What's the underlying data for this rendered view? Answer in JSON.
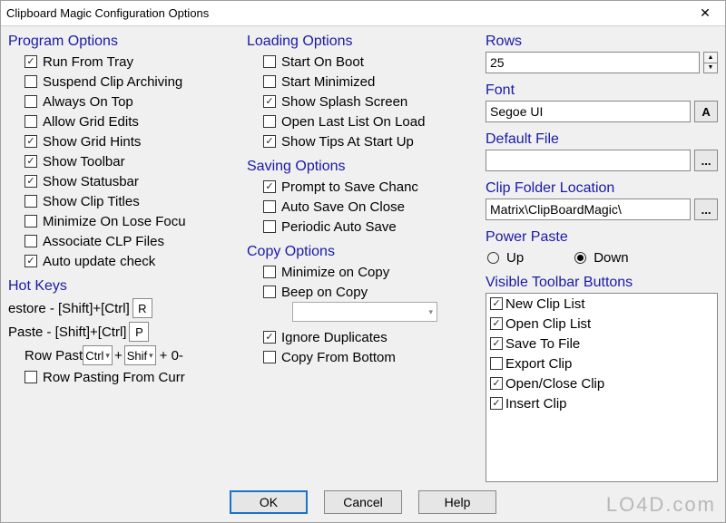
{
  "window": {
    "title": "Clipboard Magic Configuration Options"
  },
  "program_options": {
    "title": "Program Options",
    "items": [
      {
        "label": "Run From Tray",
        "checked": true
      },
      {
        "label": "Suspend Clip Archiving",
        "checked": false
      },
      {
        "label": "Always On Top",
        "checked": false
      },
      {
        "label": "Allow Grid Edits",
        "checked": false
      },
      {
        "label": "Show Grid Hints",
        "checked": true
      },
      {
        "label": "Show Toolbar",
        "checked": true
      },
      {
        "label": "Show Statusbar",
        "checked": true
      },
      {
        "label": "Show Clip Titles",
        "checked": false
      },
      {
        "label": "Minimize On Lose Focu",
        "checked": false
      },
      {
        "label": "Associate CLP Files",
        "checked": false
      },
      {
        "label": "Auto update check",
        "checked": true
      }
    ]
  },
  "hotkeys": {
    "title": "Hot Keys",
    "restore_label": "estore - [Shift]+[Ctrl]",
    "restore_key": "R",
    "paste_label": " Paste - [Shift]+[Ctrl]",
    "paste_key": "P",
    "rowpaste_prefix": "Row Past",
    "rowpaste_mod1": "Ctrl",
    "rowpaste_mod2": "Shif",
    "rowpaste_suffix": "+ 0-",
    "rowpaste_curr": "Row Pasting From Curr"
  },
  "loading_options": {
    "title": "Loading Options",
    "items": [
      {
        "label": "Start On Boot",
        "checked": false
      },
      {
        "label": "Start Minimized",
        "checked": false
      },
      {
        "label": "Show Splash Screen",
        "checked": true
      },
      {
        "label": "Open Last List On Load",
        "checked": false
      },
      {
        "label": "Show Tips At Start Up",
        "checked": true
      }
    ]
  },
  "saving_options": {
    "title": "Saving Options",
    "items": [
      {
        "label": "Prompt to Save Chanc",
        "checked": true
      },
      {
        "label": "Auto Save On Close",
        "checked": false
      },
      {
        "label": "Periodic Auto Save",
        "checked": false
      }
    ]
  },
  "copy_options": {
    "title": "Copy Options",
    "min_on_copy": {
      "label": "Minimize on Copy",
      "checked": false
    },
    "beep_on_copy": {
      "label": "Beep on Copy",
      "checked": false
    },
    "ignore_dup": {
      "label": "Ignore Duplicates",
      "checked": true
    },
    "copy_bottom": {
      "label": "Copy From Bottom",
      "checked": false
    }
  },
  "rows": {
    "title": "Rows",
    "value": "25"
  },
  "font": {
    "title": "Font",
    "value": "Segoe UI",
    "button": "A"
  },
  "default_file": {
    "title": "Default File",
    "value": "",
    "button": "..."
  },
  "clip_folder": {
    "title": "Clip Folder Location",
    "value": "Matrix\\ClipBoardMagic\\",
    "button": "..."
  },
  "power_paste": {
    "title": "Power Paste",
    "up": "Up",
    "down": "Down",
    "selected": "down"
  },
  "toolbar_buttons": {
    "title": "Visible Toolbar Buttons",
    "items": [
      {
        "label": "New Clip List",
        "checked": true
      },
      {
        "label": "Open Clip List",
        "checked": true
      },
      {
        "label": "Save To File",
        "checked": true
      },
      {
        "label": "Export Clip",
        "checked": false
      },
      {
        "label": "Open/Close Clip",
        "checked": true
      },
      {
        "label": "Insert Clip",
        "checked": true
      }
    ]
  },
  "buttons": {
    "ok": "OK",
    "cancel": "Cancel",
    "help": "Help"
  },
  "watermark": "LO4D.com"
}
